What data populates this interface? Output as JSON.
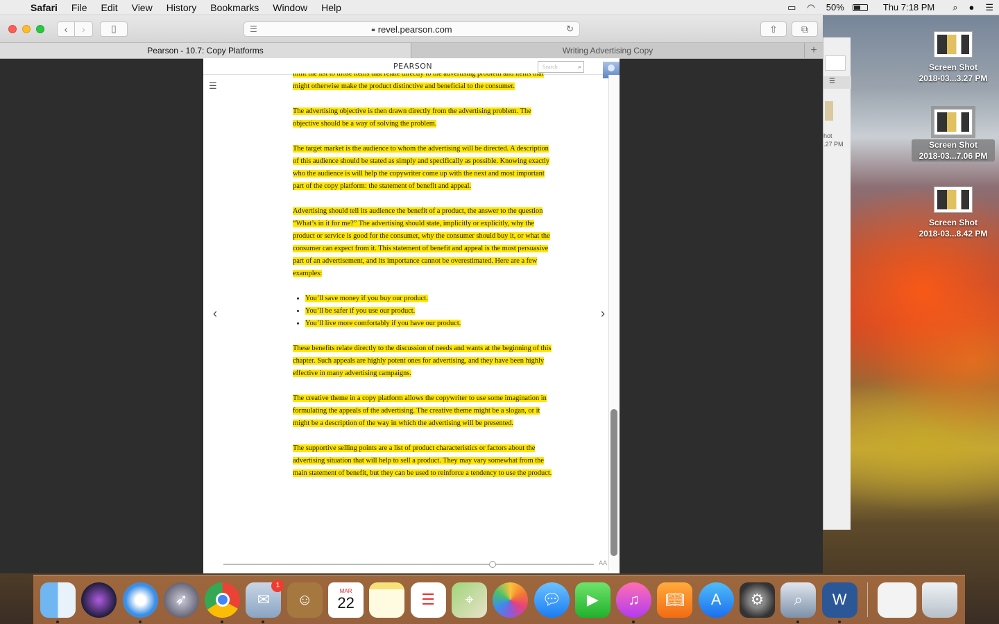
{
  "menubar": {
    "app_name": "Safari",
    "items": [
      "File",
      "Edit",
      "View",
      "History",
      "Bookmarks",
      "Window",
      "Help"
    ],
    "battery": "50%",
    "clock": "Thu 7:18 PM"
  },
  "browser": {
    "url": "revel.pearson.com",
    "tabs": [
      {
        "label": "Pearson - 10.7: Copy Platforms",
        "active": true
      },
      {
        "label": "Writing Advertising Copy",
        "active": false
      }
    ]
  },
  "page": {
    "brand": "PEARSON",
    "search_placeholder": "Search",
    "paragraphs": [
      "limit the list to those items that relate directly to the advertising problem and items that might otherwise make the product distinctive and beneficial to the consumer.",
      "The advertising objective is then drawn directly from the advertising problem. The objective should be a way of solving the problem.",
      "The target market is the audience to whom the advertising will be directed. A description of this audience should be stated as simply and specifically as possible. Knowing exactly who the audience is will help the copywriter come up with the next and most important part of the copy platform: the statement of benefit and appeal.",
      "Advertising should tell its audience the benefit of a product, the answer to the question “What’s in it for me?” The advertising should state, implicitly or explicitly, why the product or service is good for the consumer, why the consumer should buy it, or what the consumer can expect from it. This statement of benefit and appeal is the most persuasive part of an advertisement, and its importance cannot be overestimated. Here are a few examples:"
    ],
    "examples": [
      "You’ll save money if you buy our product.",
      "You’ll be safer if you use our product.",
      "You’ll live more comfortably if you have our product."
    ],
    "paragraphs_after": [
      "These benefits relate directly to the discussion of needs and wants at the beginning of this chapter. Such appeals are highly potent ones for advertising, and they have been highly effective in many advertising campaigns.",
      "The creative theme in a copy platform allows the copywriter to use some imagination in formulating the appeals of the advertising. The creative theme might be a slogan, or it might be a description of the way in which the advertising will be presented.",
      "The supportive selling points are a list of product characteristics or factors about the advertising situation that will help to sell a product. They may vary somewhat from the main statement of benefit, but they can be used to reinforce a tendency to use the product."
    ],
    "font_size_label": "AA"
  },
  "background_window": {
    "label_line1": "hot",
    "label_line2": ".27 PM"
  },
  "desktop": {
    "icons": [
      {
        "line1": "Screen Shot",
        "line2": "2018-03...3.27 PM"
      },
      {
        "line1": "Screen Shot",
        "line2": "2018-03...7.06 PM"
      },
      {
        "line1": "Screen Shot",
        "line2": "2018-03...8.42 PM"
      }
    ]
  },
  "dock": {
    "mail_badge": "1",
    "calendar_month": "MAR",
    "calendar_day": "22"
  }
}
